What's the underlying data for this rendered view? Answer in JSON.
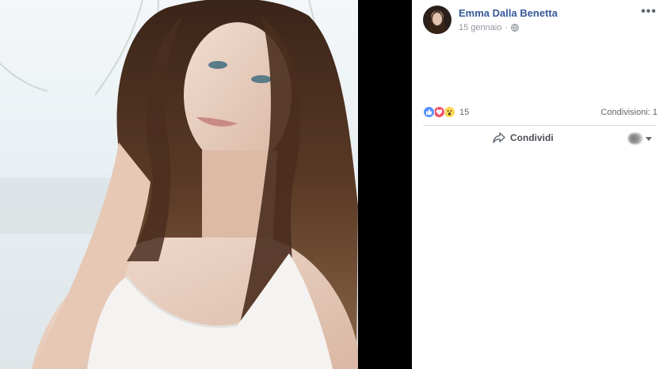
{
  "post": {
    "author": "Emma Dalla Benetta",
    "date": "15 gennaio",
    "separator": "·",
    "privacy_icon": "globe-icon",
    "more_icon": "ellipsis-icon",
    "more_label": "•••"
  },
  "reactions": {
    "types": [
      "like",
      "love",
      "wow"
    ],
    "count": "15"
  },
  "shares": {
    "label": "Condivisioni: 1"
  },
  "actions": {
    "share_label": "Condividi",
    "share_icon": "share-arrow-icon"
  },
  "colors": {
    "link_blue": "#365899",
    "photo_bg": "#000000",
    "like": "#5890ff",
    "love": "#f25268",
    "wow": "#fcd654"
  }
}
